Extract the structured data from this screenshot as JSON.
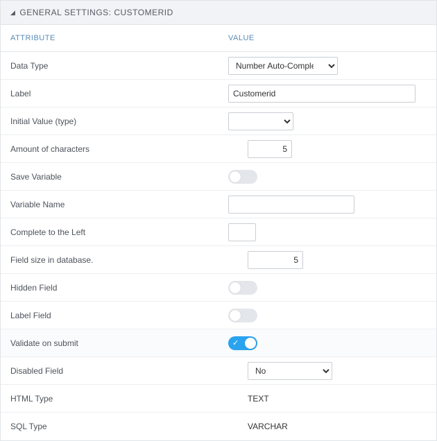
{
  "header": {
    "title": "GENERAL SETTINGS: CUSTOMERID"
  },
  "columns": {
    "attribute": "ATTRIBUTE",
    "value": "VALUE"
  },
  "rows": {
    "dataType": {
      "label": "Data Type",
      "value": "Number Auto-Complete"
    },
    "label": {
      "label": "Label",
      "value": "Customerid"
    },
    "initialValue": {
      "label": "Initial Value (type)",
      "value": ""
    },
    "amountChars": {
      "label": "Amount of characters",
      "value": "5"
    },
    "saveVariable": {
      "label": "Save Variable",
      "on": false
    },
    "variableName": {
      "label": "Variable Name",
      "value": ""
    },
    "completeLeft": {
      "label": "Complete to the Left",
      "value": ""
    },
    "fieldSize": {
      "label": "Field size in database.",
      "value": "5"
    },
    "hiddenField": {
      "label": "Hidden Field",
      "on": false
    },
    "labelField": {
      "label": "Label Field",
      "on": false
    },
    "validateSubmit": {
      "label": "Validate on submit",
      "on": true
    },
    "disabledField": {
      "label": "Disabled Field",
      "value": "No"
    },
    "htmlType": {
      "label": "HTML Type",
      "value": "TEXT"
    },
    "sqlType": {
      "label": "SQL Type",
      "value": "VARCHAR"
    }
  }
}
